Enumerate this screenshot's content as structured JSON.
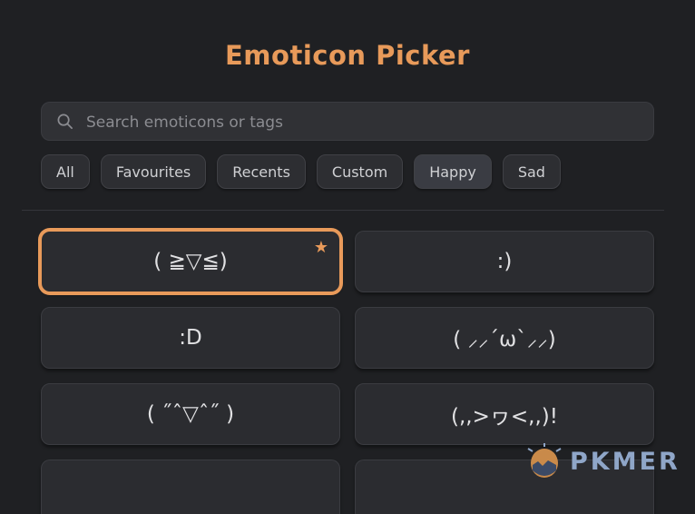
{
  "header": {
    "title": "Emoticon Picker"
  },
  "search": {
    "placeholder": "Search emoticons or tags",
    "icon": "search-icon"
  },
  "filters": [
    {
      "label": "All",
      "active": false
    },
    {
      "label": "Favourites",
      "active": false
    },
    {
      "label": "Recents",
      "active": false
    },
    {
      "label": "Custom",
      "active": false
    },
    {
      "label": "Happy",
      "active": true
    },
    {
      "label": "Sad",
      "active": false
    }
  ],
  "emoticons": [
    {
      "text": "( ≧▽≦)",
      "favourite": true,
      "selected": true
    },
    {
      "text": ":)",
      "favourite": false,
      "selected": false
    },
    {
      "text": ":D",
      "favourite": false,
      "selected": false
    },
    {
      "text": "( ⸝⸝´ω`⸝⸝)",
      "favourite": false,
      "selected": false
    },
    {
      "text": "( ˝ˆ▽ˆ˝ )",
      "favourite": false,
      "selected": false
    },
    {
      "text": "(,,>ヮ<,,)!",
      "favourite": false,
      "selected": false
    },
    {
      "text": "",
      "favourite": false,
      "selected": false
    },
    {
      "text": "",
      "favourite": false,
      "selected": false
    }
  ],
  "watermark": {
    "text": "PKMER"
  },
  "colors": {
    "accent": "#e89a5a",
    "background": "#1f2023",
    "card": "#2b2c30",
    "watermark": "#8fa6c8"
  }
}
